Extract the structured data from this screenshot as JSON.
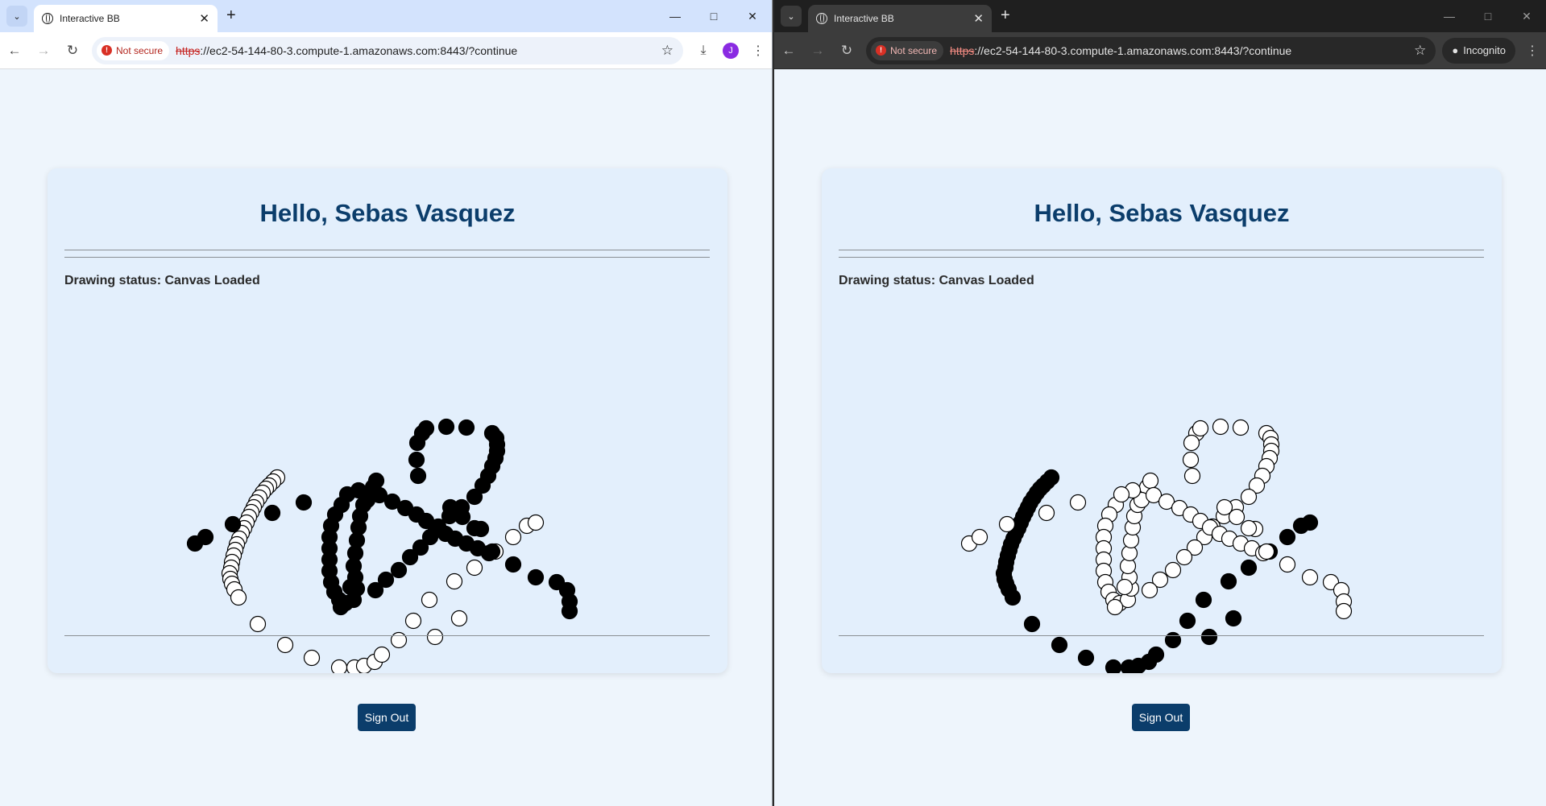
{
  "windows": [
    {
      "id": "left",
      "tab_title": "Interactive BB",
      "security_label": "Not secure",
      "url_proto": "https",
      "url_rest": "://ec2-54-144-80-3.compute-1.amazonaws.com:8443/?continue",
      "profile_initial": "J",
      "profile_color": "#8a2be2",
      "theme": "light"
    },
    {
      "id": "right",
      "tab_title": "Interactive BB",
      "security_label": "Not secure",
      "url_proto": "https",
      "url_rest": "://ec2-54-144-80-3.compute-1.amazonaws.com:8443/?continue",
      "incognito_label": "Incognito",
      "theme": "dark"
    }
  ],
  "page": {
    "greeting": "Hello, Sebas Vasquez",
    "drawing_status": "Drawing status: Canvas Loaded",
    "sign_out_label": "Sign Out",
    "heading_color": "#0b3d6b",
    "button_color": "#0b3d6b"
  },
  "strokes": {
    "colors": {
      "black": "#000000",
      "white": "#ffffff"
    },
    "left_canvas": {
      "white_dots_comment": "left arc, bottom bowl, right small arc",
      "black_dots_comment": "ampersand shape and diagonal"
    },
    "right_canvas": {
      "description": "same stroke shape with inverted colors"
    }
  }
}
